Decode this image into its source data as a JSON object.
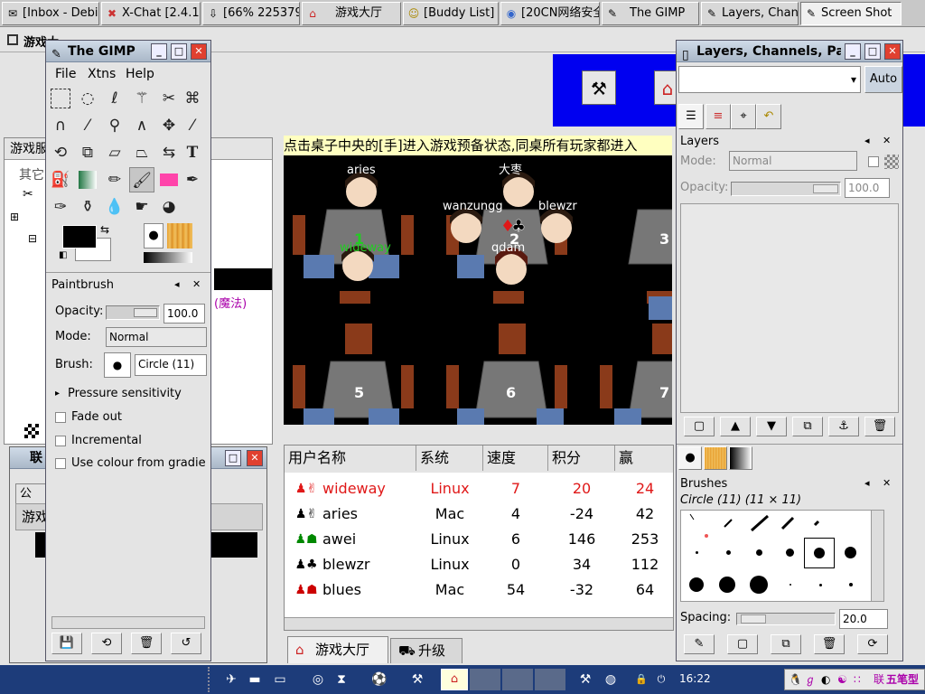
{
  "taskbar": {
    "items": [
      {
        "label": "[Inbox - Debia",
        "icon": "mail-icon"
      },
      {
        "label": "X-Chat [2.4.1",
        "icon": "xchat-icon"
      },
      {
        "label": "[66% 225379",
        "icon": "download-icon"
      },
      {
        "label": "游戏大厅",
        "icon": "house-icon"
      },
      {
        "label": "[Buddy List]",
        "icon": "buddy-icon"
      },
      {
        "label": "[20CN网络安全",
        "icon": "browser-icon"
      },
      {
        "label": "The GIMP",
        "icon": "gimp-icon"
      },
      {
        "label": "Layers, Chan",
        "icon": "gimp-icon"
      },
      {
        "label": "Screen Shot",
        "icon": "gimp-icon"
      }
    ]
  },
  "game": {
    "window_title": "游戏大",
    "tree_header": "游戏服",
    "tree_items": [
      "其它",
      "",
      "",
      ""
    ],
    "chat_snippet": "(魔法)",
    "banner_text": "点击桌子中央的[手]进入游戏预备状态,同桌所有玩家都进入",
    "players_on_tables": [
      {
        "name": "aries",
        "color": "#ffffff"
      },
      {
        "name": "大枣",
        "color": "#ffffff"
      },
      {
        "name": "wanzungg",
        "color": "#ffffff"
      },
      {
        "name": "blewzr",
        "color": "#ffffff"
      },
      {
        "name": "qdam",
        "color": "#ffffff"
      },
      {
        "name": "wideway",
        "color": "#22cc22"
      }
    ],
    "table_numbers": [
      "1",
      "2",
      "3",
      "5",
      "6",
      "7"
    ],
    "columns": [
      "用户名称",
      "系统",
      "速度",
      "积分",
      "赢"
    ],
    "rows": [
      {
        "name": "wideway",
        "system": "Linux",
        "speed": "7",
        "score": "20",
        "win": "24",
        "highlight": true
      },
      {
        "name": "aries",
        "system": "Mac",
        "speed": "4",
        "score": "-24",
        "win": "42",
        "highlight": false
      },
      {
        "name": "awei",
        "system": "Linux",
        "speed": "6",
        "score": "146",
        "win": "253",
        "highlight": false
      },
      {
        "name": "blewzr",
        "system": "Linux",
        "speed": "0",
        "score": "34",
        "win": "112",
        "highlight": false
      },
      {
        "name": "blues",
        "system": "Mac",
        "speed": "54",
        "score": "-32",
        "win": "64",
        "highlight": false
      }
    ],
    "bottom_tabs": [
      "游戏大厅",
      "升级"
    ],
    "small_window_title": "联",
    "small_window_tab": "公",
    "small_window_list": "游戏"
  },
  "gimp": {
    "title": "The GIMP",
    "menu": [
      "File",
      "Xtns",
      "Help"
    ],
    "paintbrush": {
      "title": "Paintbrush",
      "opacity_label": "Opacity:",
      "opacity_value": "100.0",
      "mode_label": "Mode:",
      "mode_value": "Normal",
      "brush_label": "Brush:",
      "brush_value": "Circle (11)",
      "pressure": "Pressure sensitivity",
      "fade": "Fade out",
      "incremental": "Incremental",
      "gradient": "Use colour from gradie"
    }
  },
  "layers": {
    "title": "Layers, Channels, Pa",
    "auto": "Auto",
    "panel_title": "Layers",
    "mode_label": "Mode:",
    "mode_value": "Normal",
    "opacity_label": "Opacity:",
    "opacity_value": "100.0",
    "brushes_title": "Brushes",
    "brush_name": "Circle (11) (11 × 11)",
    "spacing_label": "Spacing:",
    "spacing_value": "20.0"
  },
  "tray": {
    "clock": "16:22",
    "ime_label": "五笔型",
    "link_label": "联"
  },
  "colors": {
    "accent_blue": "#1d3c7a",
    "highlight_red": "#e01818",
    "table_name_green": "#22cc22"
  }
}
